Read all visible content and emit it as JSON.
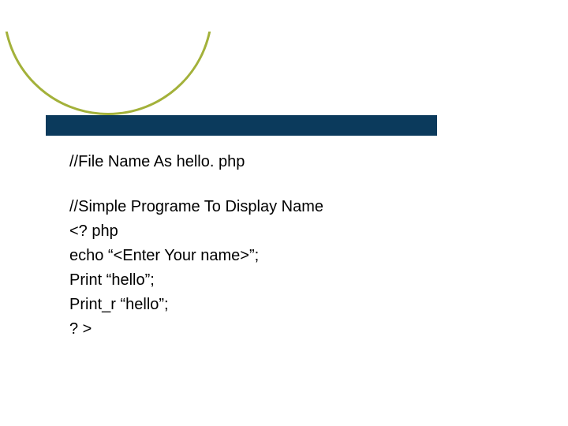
{
  "colors": {
    "bar": "#0b3a5c",
    "arc": "#a3b13a",
    "text": "#000000",
    "background": "#ffffff"
  },
  "code": {
    "block1": [
      "//File Name As hello. php"
    ],
    "block2": [
      "//Simple Programe To Display Name",
      "<? php",
      "echo “<Enter Your name>”;",
      "Print “hello”;",
      "Print_r “hello”;",
      "? >"
    ]
  }
}
